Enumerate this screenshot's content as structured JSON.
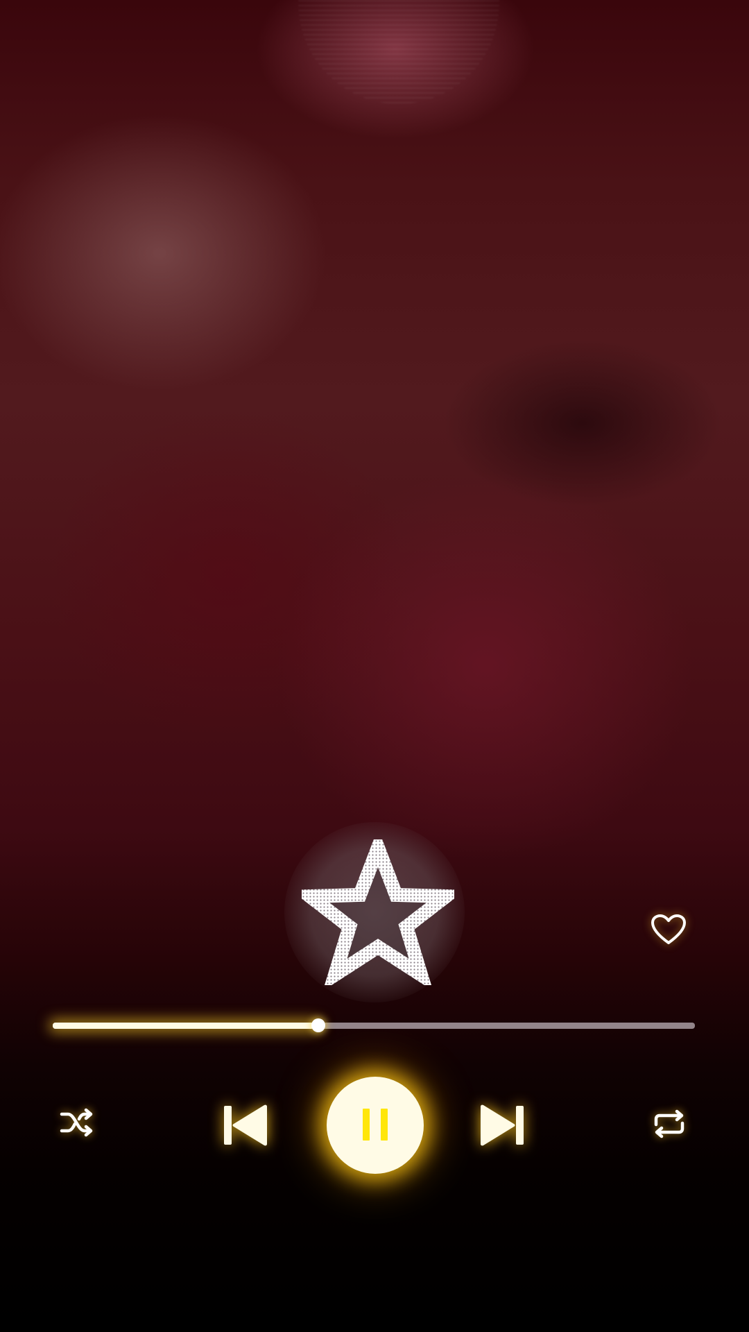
{
  "player": {
    "progress_fraction": 0.414,
    "is_playing": true,
    "liked": false,
    "favorited": false
  },
  "colors": {
    "accent_glow": "#ffc820",
    "pause_bars": "#ffe60a",
    "play_button_fill": "#fffbe6",
    "track_remaining": "#c8bec3",
    "background_top": "#4a1216",
    "background_bottom": "#000000"
  },
  "icons": {
    "favorite": "star-outline-icon",
    "like": "heart-outline-icon",
    "shuffle": "shuffle-icon",
    "previous": "skip-previous-icon",
    "play_pause": "pause-icon",
    "next": "skip-next-icon",
    "repeat": "repeat-icon"
  }
}
